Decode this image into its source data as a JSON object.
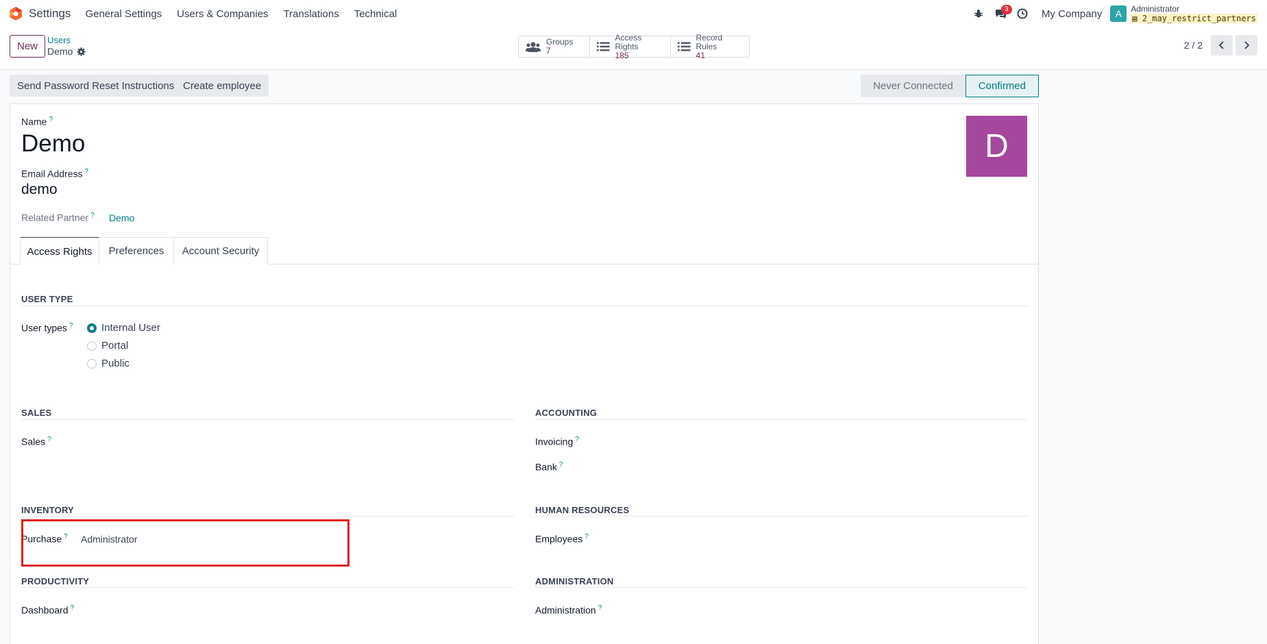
{
  "navbar": {
    "app_name": "Settings",
    "menu": [
      "General Settings",
      "Users & Companies",
      "Translations",
      "Technical"
    ],
    "chat_badge": "3",
    "company": "My Company",
    "avatar_letter": "A",
    "user_name": "Administrator",
    "db_name": "2_may_restrict_partners"
  },
  "control_panel": {
    "new_label": "New",
    "breadcrumb_parent": "Users",
    "breadcrumb_current": "Demo",
    "stats": [
      {
        "label": "Groups",
        "value": "7",
        "icon": "users-icon"
      },
      {
        "label": "Access Rights",
        "value": "185",
        "icon": "list-icon"
      },
      {
        "label": "Record Rules",
        "value": "41",
        "icon": "list-icon"
      }
    ],
    "pager": "2 / 2"
  },
  "actions": {
    "reset_password": "Send Password Reset Instructions",
    "create_employee": "Create employee",
    "stages": [
      "Never Connected",
      "Confirmed"
    ],
    "active_stage": "Confirmed"
  },
  "form": {
    "name_label": "Name",
    "name_value": "Demo",
    "email_label": "Email Address",
    "email_value": "demo",
    "partner_label": "Related Partner",
    "partner_value": "Demo",
    "avatar_letter": "D",
    "avatar_color": "#a4479d",
    "question_mark": "?"
  },
  "tabs": [
    "Access Rights",
    "Preferences",
    "Account Security"
  ],
  "access_rights": {
    "user_type_title": "USER TYPE",
    "user_types_label": "User types",
    "user_type_options": [
      "Internal User",
      "Portal",
      "Public"
    ],
    "selected_user_type": "Internal User",
    "sales_title": "SALES",
    "sales_label": "Sales",
    "accounting_title": "ACCOUNTING",
    "invoicing_label": "Invoicing",
    "bank_label": "Bank",
    "inventory_title": "INVENTORY",
    "purchase_label": "Purchase",
    "purchase_value": "Administrator",
    "hr_title": "HUMAN RESOURCES",
    "employees_label": "Employees",
    "productivity_title": "PRODUCTIVITY",
    "dashboard_label": "Dashboard",
    "administration_title": "ADMINISTRATION",
    "administration_label": "Administration"
  },
  "colors": {
    "brand": "#6b2d5c",
    "accent": "#017e84",
    "highlight": "#e11b1b"
  }
}
